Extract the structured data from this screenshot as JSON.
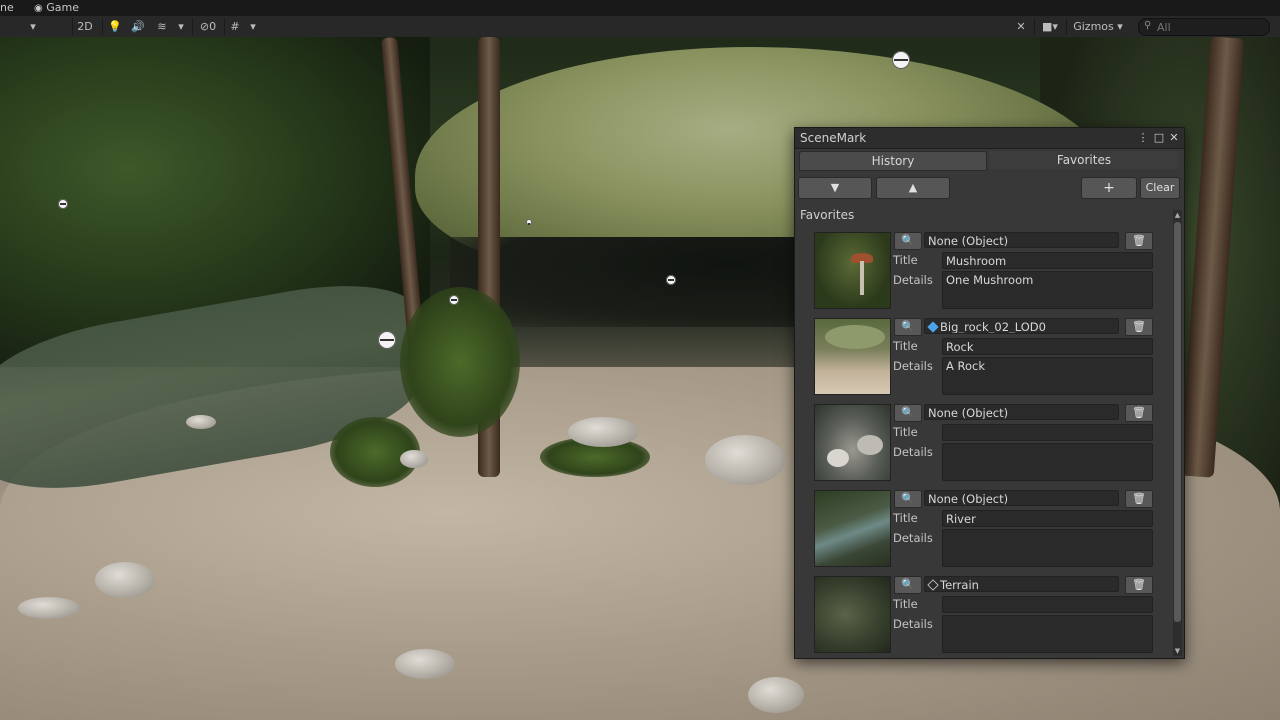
{
  "top_tabs": [
    "ne",
    "Game"
  ],
  "toolbar": {
    "mode_2d": "2D",
    "hidden_count": "0",
    "gizmos_label": "Gizmos",
    "search_placeholder": "All"
  },
  "scenemark": {
    "title": "SceneMark",
    "tabs": [
      {
        "label": "History",
        "active": true
      },
      {
        "label": "Favorites",
        "active": false
      }
    ],
    "buttons": {
      "move_down": "▼",
      "move_up": "▲",
      "add": "+",
      "clear": "Clear"
    },
    "section_label": "Favorites",
    "field_labels": {
      "title": "Title",
      "details": "Details"
    },
    "entries": [
      {
        "object": "None (Object)",
        "object_icon": "none",
        "title": "Mushroom",
        "details": "One Mushroom",
        "thumb": "mushroom"
      },
      {
        "object": "Big_rock_02_LOD0",
        "object_icon": "prefab-cube",
        "title": "Rock",
        "details": "A Rock",
        "thumb": "rock"
      },
      {
        "object": "None (Object)",
        "object_icon": "none",
        "title": "",
        "details": "",
        "thumb": "stones"
      },
      {
        "object": "None (Object)",
        "object_icon": "none",
        "title": "River",
        "details": "",
        "thumb": "river"
      },
      {
        "object": "Terrain",
        "object_icon": "terrain-cube",
        "title": "",
        "details": "",
        "thumb": "terrain"
      }
    ]
  },
  "colors": {
    "prefab": "#4da3e8",
    "accent": "#4b4b4b"
  }
}
